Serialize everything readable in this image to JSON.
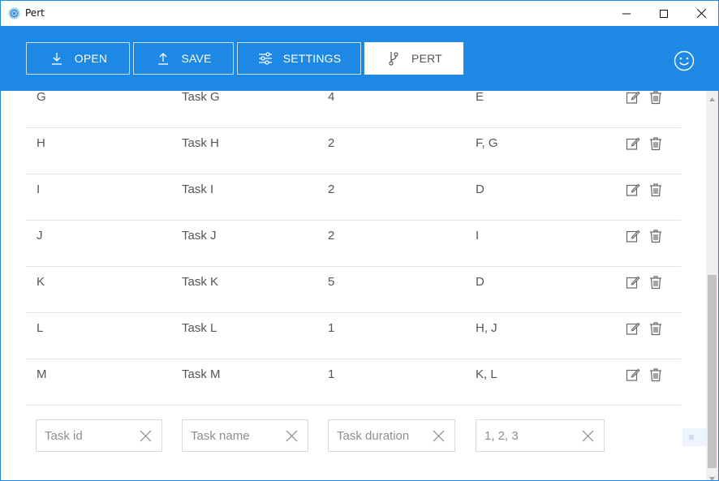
{
  "window": {
    "title": "Pert"
  },
  "toolbar": {
    "open_label": "OPEN",
    "save_label": "SAVE",
    "settings_label": "SETTINGS",
    "pert_label": "PERT",
    "active_tab": "PERT"
  },
  "colors": {
    "accent": "#1e88e5",
    "text": "#555555",
    "divider": "#e3e3e3"
  },
  "tasks": [
    {
      "id": "G",
      "name": "Task G",
      "duration": "4",
      "dependencies": "E"
    },
    {
      "id": "H",
      "name": "Task H",
      "duration": "2",
      "dependencies": "F, G"
    },
    {
      "id": "I",
      "name": "Task I",
      "duration": "2",
      "dependencies": "D"
    },
    {
      "id": "J",
      "name": "Task J",
      "duration": "2",
      "dependencies": "I"
    },
    {
      "id": "K",
      "name": "Task K",
      "duration": "5",
      "dependencies": "D"
    },
    {
      "id": "L",
      "name": "Task L",
      "duration": "1",
      "dependencies": "H, J"
    },
    {
      "id": "M",
      "name": "Task M",
      "duration": "1",
      "dependencies": "K, L"
    }
  ],
  "new_task": {
    "id_placeholder": "Task id",
    "name_placeholder": "Task name",
    "duration_placeholder": "Task duration",
    "dependencies_placeholder": "1, 2, 3",
    "id_value": "",
    "name_value": "",
    "duration_value": "",
    "dependencies_value": ""
  },
  "icons": {
    "app": "app-icon",
    "open": "download-icon",
    "save": "upload-icon",
    "settings": "sliders-icon",
    "pert": "branch-icon",
    "user": "smiley-icon",
    "row_edit": "edit-icon",
    "row_delete": "trash-icon",
    "clear": "close-icon"
  }
}
